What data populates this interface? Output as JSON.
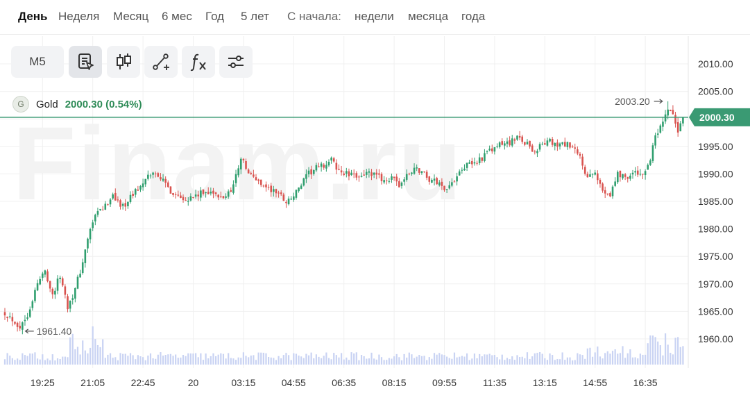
{
  "periods": {
    "items": [
      "День",
      "Неделя",
      "Месяц",
      "6 мес",
      "Год",
      "5 лет"
    ],
    "active_index": 0,
    "since_label": "С начала:",
    "since_items": [
      "недели",
      "месяца",
      "года"
    ]
  },
  "toolbar": {
    "interval_label": "M5",
    "tools": [
      "indicator-list-icon",
      "candlestick-icon",
      "draw-line-icon",
      "function-fx-icon",
      "settings-sliders-icon"
    ]
  },
  "watermark": "Finam.ru",
  "legend": {
    "icon_letter": "G",
    "name": "Gold",
    "value": "2000.30 (0.54%)"
  },
  "colors": {
    "up": "#2f9e6e",
    "down": "#d9534f",
    "current_line": "#3a9a73",
    "volume": "#c9d3f3",
    "grid": "#f0f0f0",
    "watermark": "#f3f3f3"
  },
  "chart_data": {
    "type": "candlestick",
    "symbol": "Gold",
    "interval": "M5",
    "ylim": [
      1955,
      2013
    ],
    "yticks": [
      1960,
      1965,
      1970,
      1975,
      1980,
      1985,
      1990,
      1995,
      2000,
      2005,
      2010
    ],
    "ytick_labels": [
      "1960.00",
      "1965.00",
      "1970.00",
      "1975.00",
      "1980.00",
      "1985.00",
      "1990.00",
      "1995.00",
      "2000.00",
      "2005.00",
      "2010.00"
    ],
    "xtick_labels": [
      "19:25",
      "21:05",
      "22:45",
      "20",
      "03:15",
      "04:55",
      "06:35",
      "08:15",
      "09:55",
      "11:35",
      "13:15",
      "14:55",
      "16:35"
    ],
    "xtick_bar_index": [
      15,
      35,
      55,
      75,
      95,
      115,
      135,
      155,
      175,
      195,
      215,
      235,
      255
    ],
    "day_separator_label": "20",
    "current_price": 2000.3,
    "current_price_label": "2000.30",
    "low": 1961.4,
    "low_label": "1961.40",
    "high": 2003.2,
    "high_label": "2003.20",
    "closes_anchor": [
      [
        0,
        1964.8
      ],
      [
        4,
        1963.2
      ],
      [
        6,
        1962.0
      ],
      [
        9,
        1964.5
      ],
      [
        13,
        1970.0
      ],
      [
        16,
        1972.5
      ],
      [
        19,
        1968.0
      ],
      [
        22,
        1971.5
      ],
      [
        25,
        1966.0
      ],
      [
        28,
        1969.0
      ],
      [
        31,
        1974.0
      ],
      [
        34,
        1980.0
      ],
      [
        37,
        1983.0
      ],
      [
        40,
        1984.0
      ],
      [
        43,
        1986.5
      ],
      [
        46,
        1984.0
      ],
      [
        49,
        1985.0
      ],
      [
        52,
        1987.0
      ],
      [
        55,
        1988.0
      ],
      [
        58,
        1990.0
      ],
      [
        61,
        1990.0
      ],
      [
        64,
        1988.0
      ],
      [
        67,
        1986.5
      ],
      [
        70,
        1986.0
      ],
      [
        73,
        1985.5
      ],
      [
        76,
        1986.0
      ],
      [
        79,
        1986.5
      ],
      [
        82,
        1987.0
      ],
      [
        85,
        1985.5
      ],
      [
        88,
        1986.0
      ],
      [
        91,
        1988.0
      ],
      [
        94,
        1993.0
      ],
      [
        97,
        1990.0
      ],
      [
        100,
        1989.0
      ],
      [
        103,
        1988.0
      ],
      [
        106,
        1987.0
      ],
      [
        109,
        1986.5
      ],
      [
        112,
        1985.0
      ],
      [
        115,
        1986.0
      ],
      [
        118,
        1988.0
      ],
      [
        121,
        1990.0
      ],
      [
        124,
        1991.0
      ],
      [
        127,
        1991.5
      ],
      [
        130,
        1992.5
      ],
      [
        133,
        1990.5
      ],
      [
        136,
        1990.0
      ],
      [
        139,
        1989.5
      ],
      [
        142,
        1990.0
      ],
      [
        145,
        1990.0
      ],
      [
        148,
        1989.5
      ],
      [
        151,
        1989.0
      ],
      [
        154,
        1989.0
      ],
      [
        157,
        1988.0
      ],
      [
        160,
        1989.5
      ],
      [
        163,
        1991.0
      ],
      [
        166,
        1990.5
      ],
      [
        169,
        1989.0
      ],
      [
        172,
        1988.5
      ],
      [
        175,
        1987.5
      ],
      [
        178,
        1988.0
      ],
      [
        181,
        1991.0
      ],
      [
        184,
        1991.5
      ],
      [
        187,
        1992.0
      ],
      [
        190,
        1993.0
      ],
      [
        193,
        1994.0
      ],
      [
        196,
        1995.0
      ],
      [
        199,
        1995.5
      ],
      [
        202,
        1996.0
      ],
      [
        205,
        1996.5
      ],
      [
        208,
        1995.5
      ],
      [
        211,
        1994.0
      ],
      [
        214,
        1995.5
      ],
      [
        217,
        1995.8
      ],
      [
        220,
        1995.0
      ],
      [
        223,
        1995.5
      ],
      [
        226,
        1994.5
      ],
      [
        229,
        1993.0
      ],
      [
        232,
        1989.0
      ],
      [
        235,
        1990.0
      ],
      [
        238,
        1987.0
      ],
      [
        241,
        1986.5
      ],
      [
        244,
        1990.0
      ],
      [
        247,
        1989.5
      ],
      [
        250,
        1990.0
      ],
      [
        253,
        1990.0
      ],
      [
        256,
        1991.0
      ],
      [
        259,
        1996.5
      ],
      [
        262,
        1999.0
      ],
      [
        264,
        2001.5
      ],
      [
        266,
        2001.0
      ],
      [
        268,
        1997.0
      ],
      [
        270,
        2000.3
      ]
    ]
  }
}
